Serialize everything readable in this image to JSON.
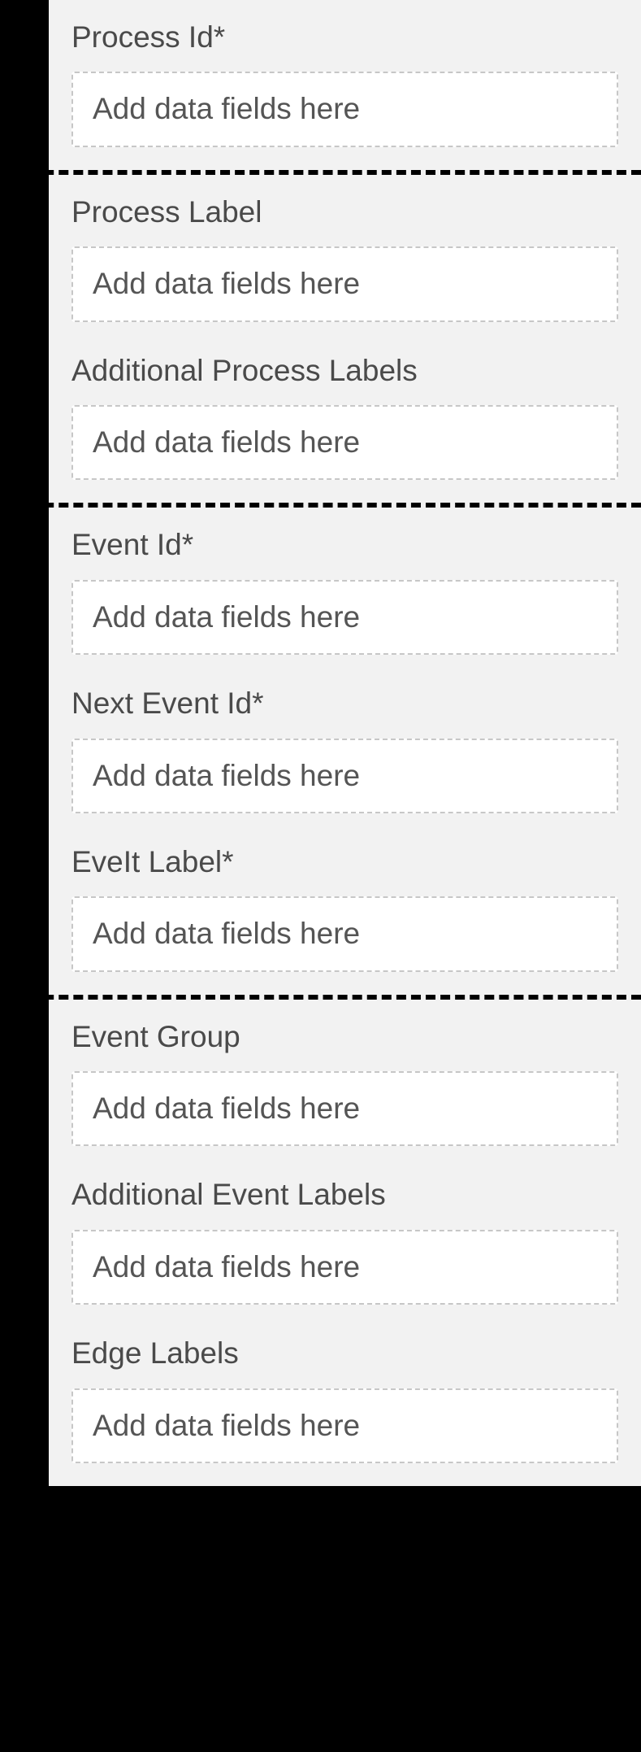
{
  "placeholder": "Add data fields here",
  "sections": [
    {
      "fields": [
        {
          "label": "Process Id*"
        }
      ]
    },
    {
      "fields": [
        {
          "label": "Process Label"
        },
        {
          "label": "Additional Process Labels"
        }
      ]
    },
    {
      "fields": [
        {
          "label": "Event Id*"
        },
        {
          "label": "Next Event Id*"
        },
        {
          "label": "EveIt Label*"
        }
      ]
    },
    {
      "fields": [
        {
          "label": "Event Group"
        },
        {
          "label": "Additional Event Labels"
        },
        {
          "label": "Edge Labels"
        }
      ]
    }
  ]
}
